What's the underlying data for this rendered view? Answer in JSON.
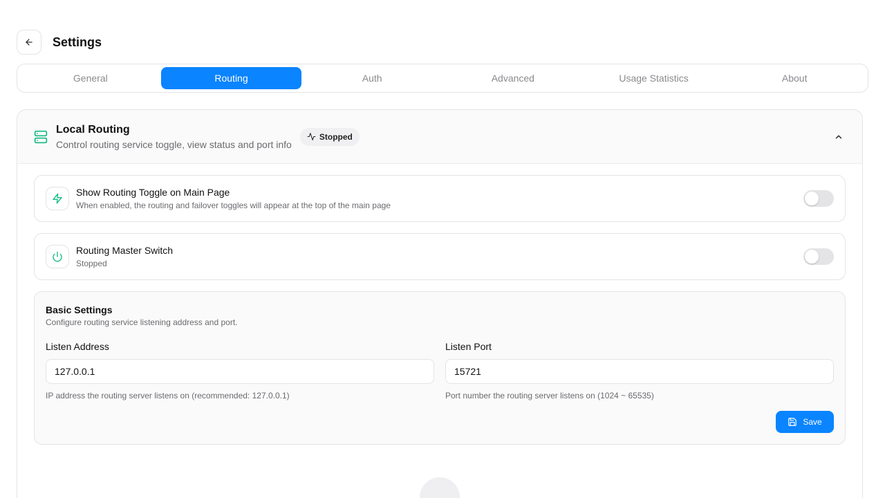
{
  "header": {
    "title": "Settings"
  },
  "tabs": [
    {
      "label": "General",
      "active": false
    },
    {
      "label": "Routing",
      "active": true
    },
    {
      "label": "Auth",
      "active": false
    },
    {
      "label": "Advanced",
      "active": false
    },
    {
      "label": "Usage Statistics",
      "active": false
    },
    {
      "label": "About",
      "active": false
    }
  ],
  "local_routing": {
    "title": "Local Routing",
    "subtitle": "Control routing service toggle, view status and port info",
    "status": "Stopped",
    "icon": "server-icon"
  },
  "rows": [
    {
      "title": "Show Routing Toggle on Main Page",
      "desc": "When enabled, the routing and failover toggles will appear at the top of the main page",
      "icon": "bolt-icon",
      "enabled": false
    },
    {
      "title": "Routing Master Switch",
      "desc": "Stopped",
      "icon": "power-icon",
      "enabled": false
    }
  ],
  "basic": {
    "title": "Basic Settings",
    "desc": "Configure routing service listening address and port.",
    "address_label": "Listen Address",
    "address_value": "127.0.0.1",
    "address_help": "IP address the routing server listens on (recommended: 127.0.0.1)",
    "port_label": "Listen Port",
    "port_value": "15721",
    "port_help": "Port number the routing server listens on (1024 ~ 65535)",
    "save_label": "Save"
  },
  "colors": {
    "accent": "#0a84ff",
    "icon_green": "#10b981"
  }
}
